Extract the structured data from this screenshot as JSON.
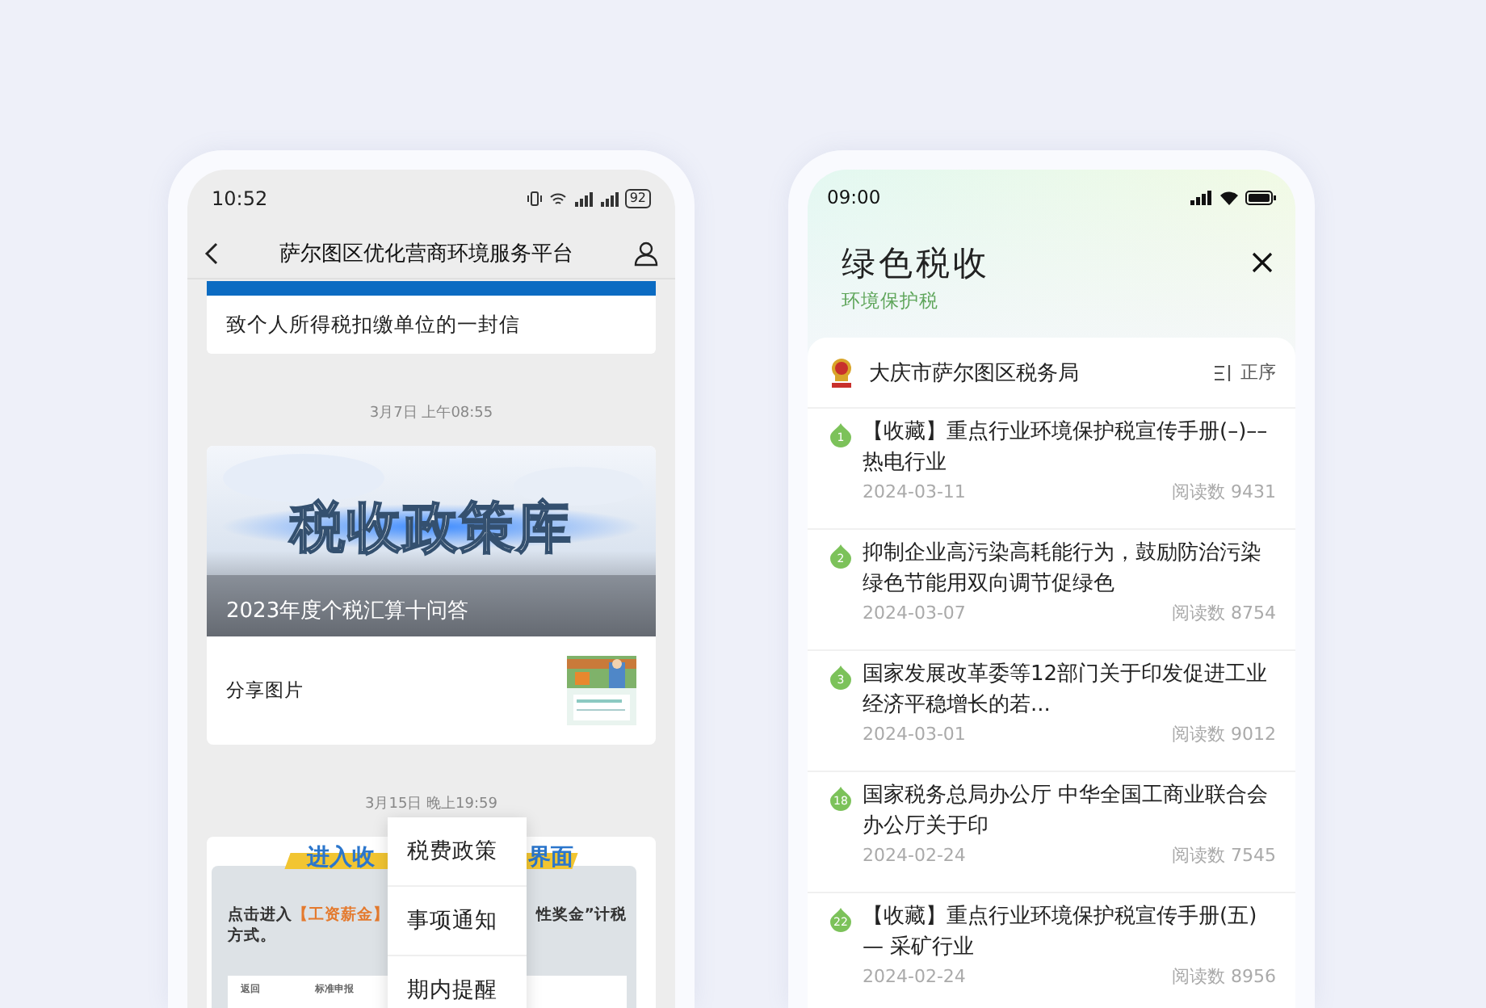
{
  "left_phone": {
    "status_bar": {
      "time": "10:52",
      "battery": "92"
    },
    "nav": {
      "title": "萨尔图区优化营商环境服务平台"
    },
    "messages": [
      {
        "kind": "letter",
        "title": "致个人所得税扣缴单位的一封信"
      },
      {
        "kind": "timestamp",
        "text": "3月7日 上午08:55"
      },
      {
        "kind": "banner",
        "banner_text": "税收政策库",
        "caption": "2023年度个税汇算十问答",
        "share_text": "分享图片"
      },
      {
        "kind": "timestamp",
        "text": "3月15日 晚上19:59"
      },
      {
        "kind": "screenshot",
        "heading_left": "进入收",
        "heading_right": "界面",
        "line_start": "点击进入",
        "highlight": "【工资薪金】",
        "line_end": "性奖金”计税",
        "line_2": "方式。",
        "back": "返回",
        "page_title": "标准申报"
      }
    ],
    "menu": [
      {
        "label": "税费政策"
      },
      {
        "label": "事项通知"
      },
      {
        "label": "期内提醒"
      }
    ]
  },
  "right_phone": {
    "status_bar": {
      "time": "09:00"
    },
    "header": {
      "title": "绿色税收",
      "subtitle": "环境保护税"
    },
    "source": {
      "name": "大庆市萨尔图区税务局",
      "sort": "正序"
    },
    "articles": [
      {
        "rank": "1",
        "title": "【收藏】重点行业环境保护税宣传手册(–)––热电行业",
        "date": "2024-03-11",
        "reads": "阅读数 9431"
      },
      {
        "rank": "2",
        "title": "抑制企业高污染高耗能行为，鼓励防治污染绿色节能用双向调节促绿色",
        "date": "2024-03-07",
        "reads": "阅读数 8754"
      },
      {
        "rank": "3",
        "title": "国家发展改革委等12部门关于印发促进工业经济平稳增长的若...",
        "date": "2024-03-01",
        "reads": "阅读数 9012"
      },
      {
        "rank": "18",
        "title": "国家税务总局办公厅 中华全国工商业联合会办公厅关于印",
        "date": "2024-02-24",
        "reads": "阅读数 7545"
      },
      {
        "rank": "22",
        "title": "【收藏】重点行业环境保护税宣传手册(五) — 采矿行业",
        "date": "2024-02-24",
        "reads": "阅读数 8956"
      }
    ]
  }
}
